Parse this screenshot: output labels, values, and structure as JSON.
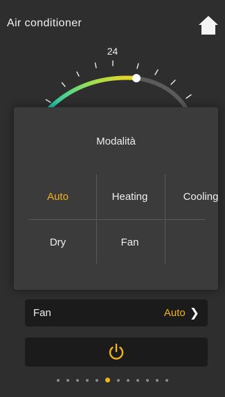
{
  "header": {
    "title": "Air conditioner",
    "home_icon": "home-icon"
  },
  "dial": {
    "setpoint": "24",
    "active_colors": [
      "#1fc9b4",
      "#9adf54",
      "#f3d21c"
    ],
    "inactive_color": "#5b5b5b",
    "tick_color": "#eeeeee"
  },
  "mode_popup": {
    "title": "Modalità",
    "options": [
      "Auto",
      "Heating",
      "Cooling",
      "Dry",
      "Fan"
    ],
    "selected": "Auto"
  },
  "fan": {
    "label": "Fan",
    "value": "Auto"
  },
  "power": {
    "icon": "power-icon",
    "color": "#f3b41b"
  },
  "pager": {
    "total": 12,
    "active_index": 5
  },
  "colors": {
    "accent": "#f3b41b",
    "background": "#2e2e2e",
    "panel": "#3b3b3b"
  }
}
